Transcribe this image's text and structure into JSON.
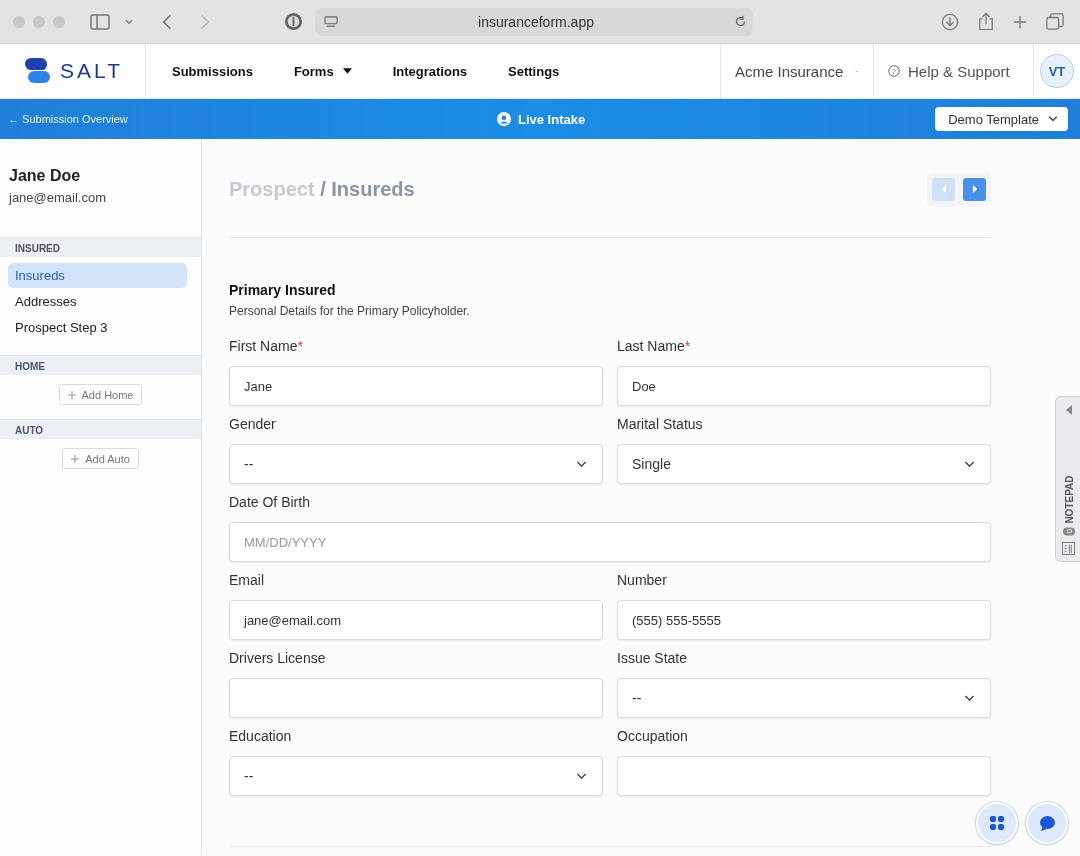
{
  "browser": {
    "url": "insuranceform.app"
  },
  "header": {
    "logo": "SALT",
    "nav": [
      {
        "label": "Submissions",
        "dropdown": false
      },
      {
        "label": "Forms",
        "dropdown": true
      },
      {
        "label": "Integrations",
        "dropdown": false
      },
      {
        "label": "Settings",
        "dropdown": false
      }
    ],
    "account": "Acme Insurance",
    "help_icon": "?",
    "help": "Help & Support",
    "avatar": "VT"
  },
  "banner": {
    "back": "← Submission Overview",
    "title": "Live Intake",
    "template": "Demo Template"
  },
  "sidebar": {
    "name": "Jane Doe",
    "email": "jane@email.com",
    "sections": [
      {
        "title": "INSURED",
        "items": [
          {
            "label": "Insureds",
            "selected": true
          },
          {
            "label": "Addresses",
            "selected": false
          },
          {
            "label": "Prospect Step 3",
            "selected": false
          }
        ]
      },
      {
        "title": "HOME",
        "add": "Add Home"
      },
      {
        "title": "AUTO",
        "add": "Add Auto"
      }
    ]
  },
  "page": {
    "crumb": "Prospect",
    "title": "/ Insureds",
    "prev_disabled": true,
    "next_disabled": false
  },
  "section": {
    "title": "Primary Insured",
    "subtitle": "Personal Details for the Primary Policyholder."
  },
  "fields": [
    {
      "label": "First Name",
      "required_mark": "*",
      "kind": "text",
      "value": "Jane",
      "wide": false
    },
    {
      "label": "Last Name",
      "required_mark": "*",
      "kind": "text",
      "value": "Doe",
      "wide": false
    },
    {
      "label": "Gender",
      "kind": "select",
      "value": "--",
      "wide": false
    },
    {
      "label": "Marital Status",
      "kind": "select",
      "value": "Single",
      "wide": false
    },
    {
      "label": "Date Of Birth",
      "kind": "text",
      "placeholder": "MM/DD/YYYY",
      "wide": true
    },
    {
      "label": "Email",
      "kind": "text",
      "value": "jane@email.com",
      "wide": false
    },
    {
      "label": "Number",
      "kind": "text",
      "value": "(555) 555-5555",
      "wide": false
    },
    {
      "label": "Drivers License",
      "kind": "text",
      "wide": false
    },
    {
      "label": "Issue State",
      "kind": "select",
      "value": "--",
      "wide": false
    },
    {
      "label": "Education",
      "kind": "select",
      "value": "--",
      "wide": false
    },
    {
      "label": "Occupation",
      "kind": "text",
      "wide": false
    }
  ],
  "notepad": {
    "label": "NOTEPAD",
    "count": "0"
  }
}
